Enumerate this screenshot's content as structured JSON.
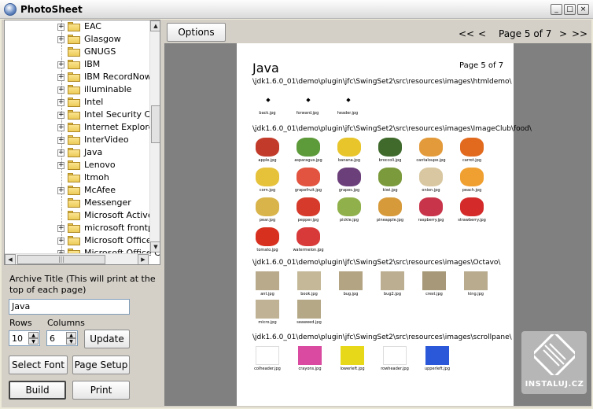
{
  "window": {
    "title": "PhotoSheet",
    "min": "_",
    "max": "□",
    "close": "×"
  },
  "tree": {
    "items": [
      {
        "label": "EAC",
        "expandable": true
      },
      {
        "label": "Glasgow",
        "expandable": true
      },
      {
        "label": "GNUGS",
        "expandable": false
      },
      {
        "label": "IBM",
        "expandable": true
      },
      {
        "label": "IBM RecordNow!",
        "expandable": true
      },
      {
        "label": "illuminable",
        "expandable": true
      },
      {
        "label": "Intel",
        "expandable": true
      },
      {
        "label": "Intel Security Che",
        "expandable": true
      },
      {
        "label": "Internet Explorer",
        "expandable": true
      },
      {
        "label": "InterVideo",
        "expandable": true
      },
      {
        "label": "Java",
        "expandable": true
      },
      {
        "label": "Lenovo",
        "expandable": true
      },
      {
        "label": "ltmoh",
        "expandable": false
      },
      {
        "label": "McAfee",
        "expandable": true
      },
      {
        "label": "Messenger",
        "expandable": false
      },
      {
        "label": "Microsoft ActiveS",
        "expandable": false
      },
      {
        "label": "microsoft frontpa",
        "expandable": true
      },
      {
        "label": "Microsoft Office",
        "expandable": true
      },
      {
        "label": "Microsoft Office C",
        "expandable": true
      }
    ]
  },
  "form": {
    "archive_title_label": "Archive Title (This will print at the top of each page)",
    "archive_title_value": "Java",
    "rows_label": "Rows",
    "rows_value": "10",
    "columns_label": "Columns",
    "columns_value": "6",
    "update_label": "Update",
    "select_font_label": "Select Font",
    "page_setup_label": "Page Setup",
    "build_label": "Build",
    "print_label": "Print"
  },
  "toolbar": {
    "options_label": "Options",
    "first": "<<",
    "prev": "<",
    "page_indicator": "Page 5 of 7",
    "next": ">",
    "last": ">>"
  },
  "page": {
    "title": "Java",
    "page_number": "Page 5 of 7",
    "sections": [
      {
        "path": "\\jdk1.6.0_01\\demo\\plugin\\jfc\\SwingSet2\\src\\resources\\images\\htmldemo\\",
        "thumbs": [
          {
            "caption": "back.jpg",
            "color": "#ffffff",
            "icon": "back-text"
          },
          {
            "caption": "forward.jpg",
            "color": "#ffffff",
            "icon": "forward-text"
          },
          {
            "caption": "header.jpg",
            "color": "#ffffff",
            "icon": "header-text"
          }
        ]
      },
      {
        "path": "\\jdk1.6.0_01\\demo\\plugin\\jfc\\SwingSet2\\src\\resources\\images\\ImageClub\\food\\",
        "thumbs": [
          {
            "caption": "apple.jpg",
            "color": "#c23b2a"
          },
          {
            "caption": "asparagus.jpg",
            "color": "#5d9a3a"
          },
          {
            "caption": "banana.jpg",
            "color": "#e8c52a"
          },
          {
            "caption": "broccoli.jpg",
            "color": "#3f6a2c"
          },
          {
            "caption": "cantaloupe.jpg",
            "color": "#e39a3b"
          },
          {
            "caption": "carrot.jpg",
            "color": "#e26a1f"
          },
          {
            "caption": "corn.jpg",
            "color": "#e6c23a"
          },
          {
            "caption": "grapefruit.jpg",
            "color": "#e2543f"
          },
          {
            "caption": "grapes.jpg",
            "color": "#6b3f7a"
          },
          {
            "caption": "kiwi.jpg",
            "color": "#7a9a3b"
          },
          {
            "caption": "onion.jpg",
            "color": "#d8c7a0"
          },
          {
            "caption": "peach.jpg",
            "color": "#f0a030"
          },
          {
            "caption": "pear.jpg",
            "color": "#d9b44a"
          },
          {
            "caption": "pepper.jpg",
            "color": "#d63a2a"
          },
          {
            "caption": "pickle.jpg",
            "color": "#8fb04a"
          },
          {
            "caption": "pineapple.jpg",
            "color": "#d79a3a"
          },
          {
            "caption": "raspberry.jpg",
            "color": "#c8344a"
          },
          {
            "caption": "strawberry.jpg",
            "color": "#d42a2a"
          },
          {
            "caption": "tomato.jpg",
            "color": "#d8301f"
          },
          {
            "caption": "watermelon.jpg",
            "color": "#d83a3a"
          }
        ]
      },
      {
        "path": "\\jdk1.6.0_01\\demo\\plugin\\jfc\\SwingSet2\\src\\resources\\images\\Octavo\\",
        "thumbs": [
          {
            "caption": "ant.jpg",
            "color": "#b9aa8c"
          },
          {
            "caption": "book.jpg",
            "color": "#c4b898"
          },
          {
            "caption": "bug.jpg",
            "color": "#b3a584"
          },
          {
            "caption": "bug2.jpg",
            "color": "#bcae90"
          },
          {
            "caption": "crest.jpg",
            "color": "#a69878"
          },
          {
            "caption": "king.jpg",
            "color": "#b8ab8e"
          },
          {
            "caption": "micro.jpg",
            "color": "#c0b294"
          },
          {
            "caption": "seaweed.jpg",
            "color": "#b5a887"
          }
        ]
      },
      {
        "path": "\\jdk1.6.0_01\\demo\\plugin\\jfc\\SwingSet2\\src\\resources\\images\\scrollpane\\",
        "thumbs": [
          {
            "caption": "colheader.jpg",
            "color": "#ffffff"
          },
          {
            "caption": "crayons.jpg",
            "color": "#d94aa0"
          },
          {
            "caption": "lowerleft.jpg",
            "color": "#e8d81a"
          },
          {
            "caption": "rowheader.jpg",
            "color": "#ffffff"
          },
          {
            "caption": "upperleft.jpg",
            "color": "#2a58d8"
          }
        ]
      }
    ]
  },
  "watermark": {
    "text": "INSTALUJ.CZ"
  }
}
